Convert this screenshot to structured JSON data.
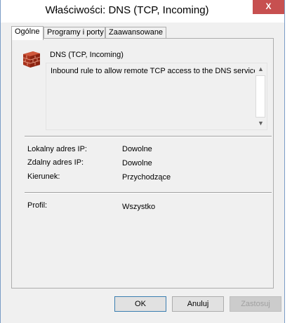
{
  "window": {
    "title": "Właściwości: DNS (TCP, Incoming)",
    "close_label": "X"
  },
  "tabs": [
    {
      "label": "Ogólne",
      "active": true
    },
    {
      "label": "Programy i porty",
      "active": false
    },
    {
      "label": "Zaawansowane",
      "active": false
    }
  ],
  "general": {
    "rule_icon": "firewall-brick-icon",
    "rule_name": "DNS (TCP, Incoming)",
    "description": "Inbound rule to allow remote TCP access to the DNS service.",
    "scroll_up": "▲",
    "scroll_down": "▼",
    "fields": [
      {
        "label": "Lokalny adres IP:",
        "value": "Dowolne"
      },
      {
        "label": "Zdalny adres IP:",
        "value": "Dowolne"
      },
      {
        "label": "Kierunek:",
        "value": "Przychodzące"
      }
    ],
    "profile": {
      "label": "Profil:",
      "value": "Wszystko"
    }
  },
  "buttons": {
    "ok": "OK",
    "cancel": "Anuluj",
    "apply": "Zastosuj"
  }
}
